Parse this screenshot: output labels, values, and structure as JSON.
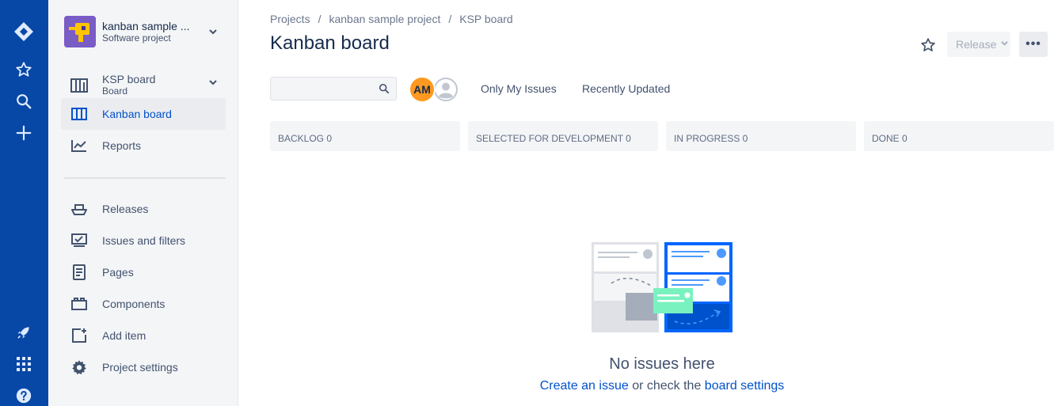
{
  "colors": {
    "global_nav": "#0747a6",
    "link": "#0052cc",
    "avatar_am": "#ff991f",
    "project_avatar": "#7a5cc5"
  },
  "global_nav": {
    "icons": [
      "jira-logo-icon",
      "star-icon",
      "search-icon",
      "plus-icon",
      "rocket-icon",
      "app-grid-icon",
      "help-icon"
    ]
  },
  "project": {
    "name": "kanban sample ...",
    "type": "Software project"
  },
  "board": {
    "name": "KSP board",
    "type": "Board"
  },
  "sidebar": {
    "items": [
      {
        "label": "Kanban board",
        "icon": "board-columns-icon",
        "active": true
      },
      {
        "label": "Reports",
        "icon": "chart-icon"
      },
      {
        "label": "Releases",
        "icon": "ship-icon"
      },
      {
        "label": "Issues and filters",
        "icon": "issues-icon"
      },
      {
        "label": "Pages",
        "icon": "page-icon"
      },
      {
        "label": "Components",
        "icon": "components-icon"
      },
      {
        "label": "Add item",
        "icon": "add-item-icon"
      },
      {
        "label": "Project settings",
        "icon": "gear-icon"
      }
    ]
  },
  "breadcrumb": [
    "Projects",
    "kanban sample project",
    "KSP board"
  ],
  "breadcrumb_separator": "/",
  "page_title": "Kanban board",
  "header": {
    "release_label": "Release",
    "more_label": "•••"
  },
  "search": {
    "placeholder": "",
    "value": ""
  },
  "avatars": {
    "initials": "AM"
  },
  "quick_filters": [
    "Only My Issues",
    "Recently Updated"
  ],
  "columns": [
    "BACKLOG 0",
    "SELECTED FOR DEVELOPMENT 0",
    "IN PROGRESS 0",
    "DONE 0"
  ],
  "empty_state": {
    "title": "No issues here",
    "link1": "Create an issue",
    "middle": " or check the ",
    "link2": "board settings"
  }
}
